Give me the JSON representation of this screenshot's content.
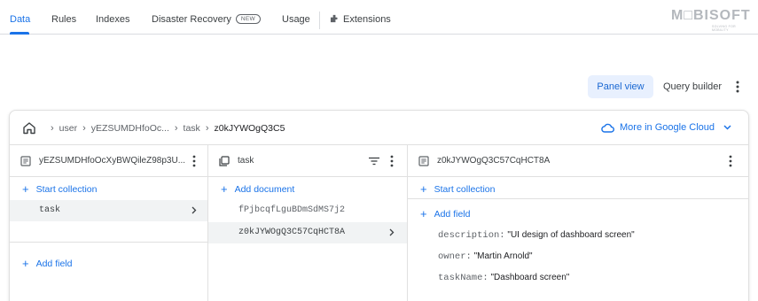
{
  "tabs": {
    "data": "Data",
    "rules": "Rules",
    "indexes": "Indexes",
    "disaster_recovery": "Disaster Recovery",
    "new_badge": "NEW",
    "usage": "Usage",
    "extensions": "Extensions"
  },
  "logo": {
    "text": "M□BISOFT",
    "sub": "SOLVING FOR MOBILITY"
  },
  "views": {
    "panel_view": "Panel view",
    "query_builder": "Query builder"
  },
  "breadcrumb": {
    "root": "user",
    "doc": "yEZSUMDHfoOc...",
    "collection": "task",
    "current": "z0kJYWOgQ3C5"
  },
  "gcloud_label": "More in Google Cloud",
  "col1": {
    "title": "yEZSUMDHfoOcXyBWQileZ98p3U...",
    "start_collection": "Start collection",
    "items": [
      "task"
    ],
    "add_field": "Add field"
  },
  "col2": {
    "title": "task",
    "add_document": "Add document",
    "items": [
      "fPjbcqfLguBDmSdMS7j2",
      "z0kJYWOgQ3C57CqHCT8A"
    ]
  },
  "col3": {
    "title": "z0kJYWOgQ3C57CqHCT8A",
    "start_collection": "Start collection",
    "add_field": "Add field",
    "fields": [
      {
        "key": "description:",
        "value": "\"UI design of dashboard screen\""
      },
      {
        "key": "owner:",
        "value": "\"Martin Arnold\""
      },
      {
        "key": "taskName:",
        "value": "\"Dashboard screen\""
      }
    ]
  },
  "colors": {
    "accent": "#1a73e8",
    "selected_bg": "#f1f3f4",
    "panel_view_bg": "#e8f0fe"
  }
}
